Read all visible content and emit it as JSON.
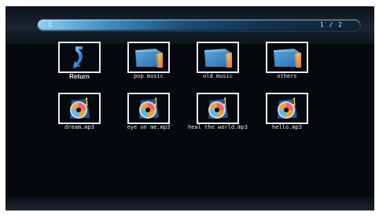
{
  "header": {
    "path": "C",
    "page": "1 / 2"
  },
  "items": [
    {
      "label": "Return",
      "icon": "return-icon"
    },
    {
      "label": "pop music",
      "icon": "folder-icon"
    },
    {
      "label": "old music",
      "icon": "folder-icon"
    },
    {
      "label": "others",
      "icon": "folder-icon"
    },
    {
      "label": "dream.mp3",
      "icon": "music-disc-icon"
    },
    {
      "label": "eye on me.mp3",
      "icon": "music-disc-icon"
    },
    {
      "label": "heal the world.mp3",
      "icon": "music-disc-icon"
    },
    {
      "label": "hello.mp3",
      "icon": "music-disc-icon"
    }
  ],
  "colors": {
    "accent": "#3e8cc2",
    "background": "#05080d",
    "thumb_border": "#e8eef3"
  }
}
